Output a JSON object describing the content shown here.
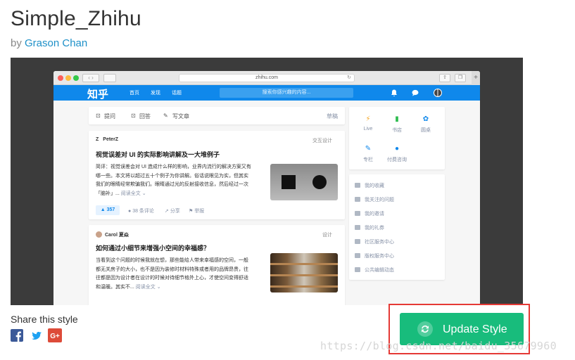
{
  "header": {
    "title": "Simple_Zhihu",
    "by_prefix": "by",
    "author": "Grason Chan"
  },
  "browser": {
    "url": "zhihu.com",
    "reload_glyph": "↻",
    "back_glyph": "‹ ›"
  },
  "zhihu_nav": {
    "logo": "知乎",
    "links": [
      "首页",
      "发现",
      "话题"
    ],
    "search_placeholder": "搜索你感兴趣的内容..."
  },
  "write_bar": {
    "items": [
      "提问",
      "回答",
      "写文章"
    ],
    "drafts": "草稿"
  },
  "feed": [
    {
      "author": "PeterZ",
      "topic": "交互设计",
      "title": "视觉误差对 UI 的实际影响讲解及一大堆例子",
      "lines": [
        "简评：视觉误差会对 UI 造成什么样的影响，业界内流行的解决方案又有",
        "哪一些。本文将以超过五十个例子为你讲解。俗话说眼见为实，但其实",
        "我们的眼睛经常欺骗我们。眼睛通过光的反射接收信息，然后经过一次",
        "「脑补」..."
      ],
      "read_more": "阅读全文 ⌄",
      "votes": "357",
      "comments": "38 条评论",
      "share": "分享",
      "report": "举报"
    },
    {
      "author": "Carol 夏焱",
      "topic": "设计",
      "title": "如何通过小细节来增强小空间的幸福感？",
      "lines": [
        "当看到这个问题的时候我就在想，那些能给人带来幸福感的空间，一般",
        "都无关房子的大小，也不是因为装修时材料特殊或者用的品牌昂贵，往",
        "往都是因为设计者在设计的时候对待细节格外上心，才使空间变得舒适",
        "和温暖。其实不..."
      ],
      "read_more": "阅读全文 ⌄"
    }
  ],
  "sidebar": {
    "quick": [
      {
        "label": "Live",
        "icon": "lightning-icon",
        "color": "#f5a623"
      },
      {
        "label": "书店",
        "icon": "book-icon",
        "color": "#2ebc4f"
      },
      {
        "label": "圆桌",
        "icon": "flower-icon",
        "color": "#0f88eb"
      },
      {
        "label": "专栏",
        "icon": "pen-icon",
        "color": "#0f88eb"
      },
      {
        "label": "付费咨询",
        "icon": "chat-icon",
        "color": "#0f88eb"
      }
    ],
    "menu": [
      "我的收藏",
      "我关注的问题",
      "我的邀请",
      "我的礼券",
      "社区服务中心",
      "版权服务中心",
      "公共编辑动态"
    ]
  },
  "share": {
    "label": "Share this style",
    "facebook": "f",
    "twitter": "t",
    "google": "G+"
  },
  "update_button": {
    "label": "Update Style"
  },
  "watermark": "https://blog.csdn.net/baidu_35679960",
  "colors": {
    "zhihu_blue": "#0f88eb",
    "update_green": "#18bc7c",
    "highlight_red": "#e53935",
    "link_blue": "#1e90c8"
  }
}
